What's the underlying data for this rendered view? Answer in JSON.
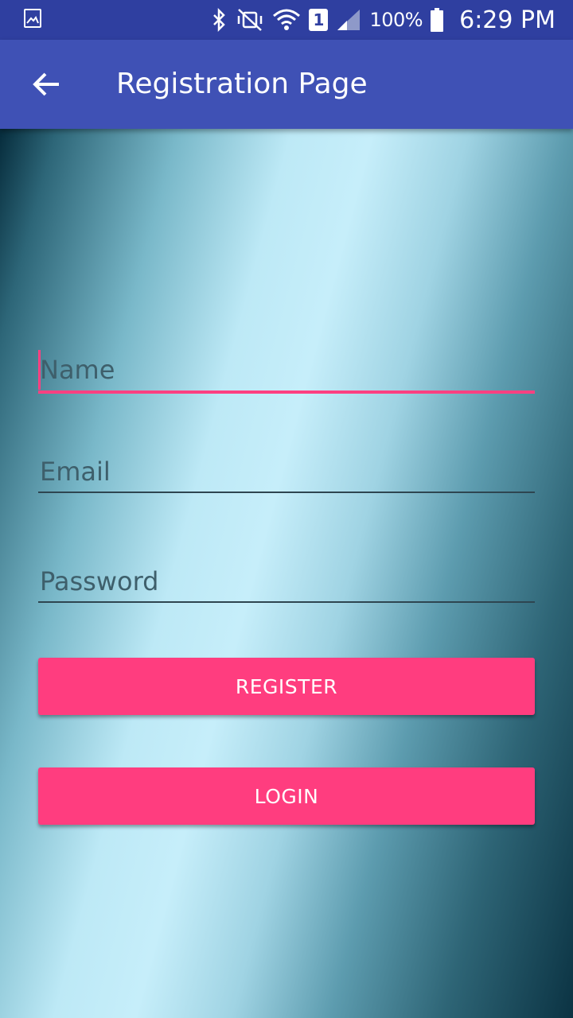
{
  "status_bar": {
    "icons": [
      "gallery-icon",
      "bluetooth-icon",
      "vibrate-icon",
      "wifi-icon",
      "sim-icon",
      "signal-icon",
      "battery-icon"
    ],
    "sim_label": "1",
    "battery_percent": "100%",
    "time": "6:29 PM",
    "background": "#2f3fa0"
  },
  "app_bar": {
    "title": "Registration Page",
    "back_icon": "arrow-back-icon",
    "background": "#3f51b5"
  },
  "form": {
    "name": {
      "value": "",
      "placeholder": "Name",
      "focused": true
    },
    "email": {
      "value": "",
      "placeholder": "Email"
    },
    "password": {
      "value": "",
      "placeholder": "Password"
    }
  },
  "buttons": {
    "register_label": "REGISTER",
    "login_label": "LOGIN",
    "color": "#ff4081"
  }
}
